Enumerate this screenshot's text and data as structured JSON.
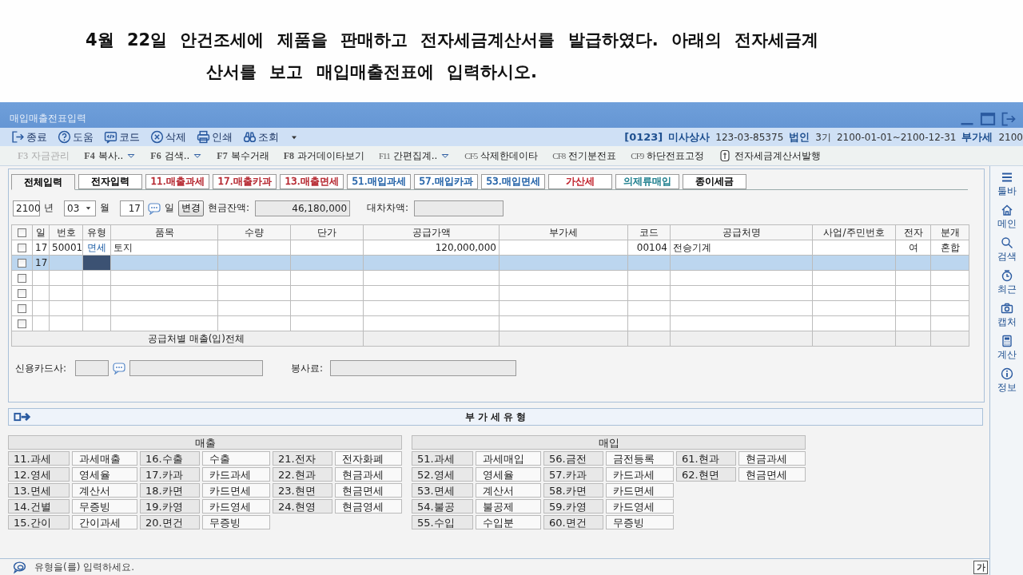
{
  "question": "4월 22일 안건조세에 제품을 판매하고 전자세금계산서를 발급하였다. 아래의 전자세금계\n산서를 보고 매입매출전표에 입력하시오.",
  "window": {
    "title": "매입매출전표입력"
  },
  "toolbar": {
    "buttons": [
      {
        "label": "종료"
      },
      {
        "label": "도움"
      },
      {
        "label": "코드"
      },
      {
        "label": "삭제"
      },
      {
        "label": "인쇄"
      },
      {
        "label": "조회"
      }
    ],
    "company": {
      "code": "[0123]",
      "name": "미사상사",
      "business_number": "123-03-85375",
      "entity": "법인",
      "term": "3기",
      "period": "2100-01-01~2100-12-31",
      "tax": "부가세",
      "year": "2100"
    }
  },
  "function_keys": [
    {
      "kind": "key",
      "key": "F3",
      "label": "자금관리",
      "disabled": true,
      "dropdown": false
    },
    {
      "kind": "key",
      "key": "F4",
      "label": "복사..",
      "disabled": false,
      "dropdown": true
    },
    {
      "kind": "key",
      "key": "F6",
      "label": "검색..",
      "disabled": false,
      "dropdown": true
    },
    {
      "kind": "key",
      "key": "F7",
      "label": "복수거래",
      "disabled": false,
      "dropdown": false
    },
    {
      "kind": "key",
      "key": "F8",
      "label": "과거데이타보기",
      "disabled": false,
      "dropdown": false
    },
    {
      "kind": "key",
      "key": "F11",
      "label": "간편집계..",
      "disabled": false,
      "dropdown": true
    },
    {
      "kind": "key",
      "key": "CF5",
      "label": "삭제한데이타",
      "disabled": false,
      "dropdown": false
    },
    {
      "kind": "key",
      "key": "CF8",
      "label": "전기분전표",
      "disabled": false,
      "dropdown": false
    },
    {
      "kind": "key",
      "key": "CF9",
      "label": "하단전표고정",
      "disabled": false,
      "dropdown": false
    },
    {
      "kind": "icon",
      "label": "전자세금계산서발행",
      "disabled": false,
      "dropdown": false
    }
  ],
  "tabs": [
    {
      "label": "전체입력",
      "selected": true,
      "color": "#000000"
    },
    {
      "label": "전자입력",
      "selected": false,
      "color": "#000000"
    },
    {
      "label": "11.매출과세",
      "selected": false,
      "color": "#b4232c"
    },
    {
      "label": "17.매출카과",
      "selected": false,
      "color": "#b4232c"
    },
    {
      "label": "13.매출면세",
      "selected": false,
      "color": "#b4232c"
    },
    {
      "label": "51.매입과세",
      "selected": false,
      "color": "#1f5fa6"
    },
    {
      "label": "57.매입카과",
      "selected": false,
      "color": "#1f5fa6"
    },
    {
      "label": "53.매입면세",
      "selected": false,
      "color": "#1f5fa6"
    },
    {
      "label": "가산세",
      "selected": false,
      "color": "#c0202a"
    },
    {
      "label": "의제류매입",
      "selected": false,
      "color": "#1a7d8c"
    },
    {
      "label": "종이세금",
      "selected": false,
      "color": "#000000"
    }
  ],
  "date_row": {
    "year": "2100",
    "year_label": "년",
    "month": "03",
    "month_label": "월",
    "day": "17",
    "day_label": "일",
    "change_button": "변경",
    "cash_label": "현금잔액:",
    "cash_value": "46,180,000",
    "difference_label": "대차차액:"
  },
  "table": {
    "header_checked": false,
    "columns": [
      "일",
      "번호",
      "유형",
      "품목",
      "수량",
      "단가",
      "공급가액",
      "부가세",
      "코드",
      "공급처명",
      "사업/주민번호",
      "전자",
      "분개"
    ],
    "rows": [
      {
        "checked": false,
        "selected": false,
        "type_focused": false,
        "day": "17",
        "number": "50001",
        "type": "면세",
        "item": "토지",
        "supply_amount": "120,000,000",
        "code": "00104",
        "supplier": "전승기계",
        "electronic": "여",
        "journal": "혼합"
      },
      {
        "checked": false,
        "selected": true,
        "type_focused": true,
        "day": "17"
      },
      {
        "checked": false,
        "selected": false,
        "type_focused": false
      },
      {
        "checked": false,
        "selected": false,
        "type_focused": false
      },
      {
        "checked": false,
        "selected": false,
        "type_focused": false
      },
      {
        "checked": false,
        "selected": false,
        "type_focused": false
      }
    ],
    "footer": "공급처별 매출(입)전체"
  },
  "card_row": {
    "card_label": "신용카드사:",
    "service_label": "봉사료:"
  },
  "vat_types": {
    "title": "부 가 세 유 형",
    "groups": [
      {
        "title": "매출",
        "rows": [
          [
            {
              "code": "11.과세",
              "name": "과세매출"
            },
            {
              "code": "16.수출",
              "name": "수출"
            },
            {
              "code": "21.전자",
              "name": "전자화폐"
            }
          ],
          [
            {
              "code": "12.영세",
              "name": "영세율"
            },
            {
              "code": "17.카과",
              "name": "카드과세"
            },
            {
              "code": "22.현과",
              "name": "현금과세"
            }
          ],
          [
            {
              "code": "13.면세",
              "name": "계산서"
            },
            {
              "code": "18.카면",
              "name": "카드면세"
            },
            {
              "code": "23.현면",
              "name": "현금면세"
            }
          ],
          [
            {
              "code": "14.건별",
              "name": "무증빙"
            },
            {
              "code": "19.카영",
              "name": "카드영세"
            },
            {
              "code": "24.현영",
              "name": "현금영세"
            }
          ],
          [
            {
              "code": "15.간이",
              "name": "간이과세"
            },
            {
              "code": "20.면건",
              "name": "무증빙"
            }
          ]
        ]
      },
      {
        "title": "매입",
        "rows": [
          [
            {
              "code": "51.과세",
              "name": "과세매입"
            },
            {
              "code": "56.금전",
              "name": "금전등록"
            },
            {
              "code": "61.현과",
              "name": "현금과세"
            }
          ],
          [
            {
              "code": "52.영세",
              "name": "영세율"
            },
            {
              "code": "57.카과",
              "name": "카드과세"
            },
            {
              "code": "62.현면",
              "name": "현금면세"
            }
          ],
          [
            {
              "code": "53.면세",
              "name": "계산서"
            },
            {
              "code": "58.카면",
              "name": "카드면세"
            }
          ],
          [
            {
              "code": "54.불공",
              "name": "불공제"
            },
            {
              "code": "59.카영",
              "name": "카드영세"
            }
          ],
          [
            {
              "code": "55.수입",
              "name": "수입분"
            },
            {
              "code": "60.면건",
              "name": "무증빙"
            }
          ]
        ]
      }
    ]
  },
  "status_bar": {
    "message": "유형을(를) 입력하세요.",
    "ime": "가"
  },
  "sidebar": [
    {
      "label": "툴바"
    },
    {
      "label": "메인"
    },
    {
      "label": "검색"
    },
    {
      "label": "최근"
    },
    {
      "label": "캡처"
    },
    {
      "label": "계산"
    },
    {
      "label": "정보"
    }
  ]
}
